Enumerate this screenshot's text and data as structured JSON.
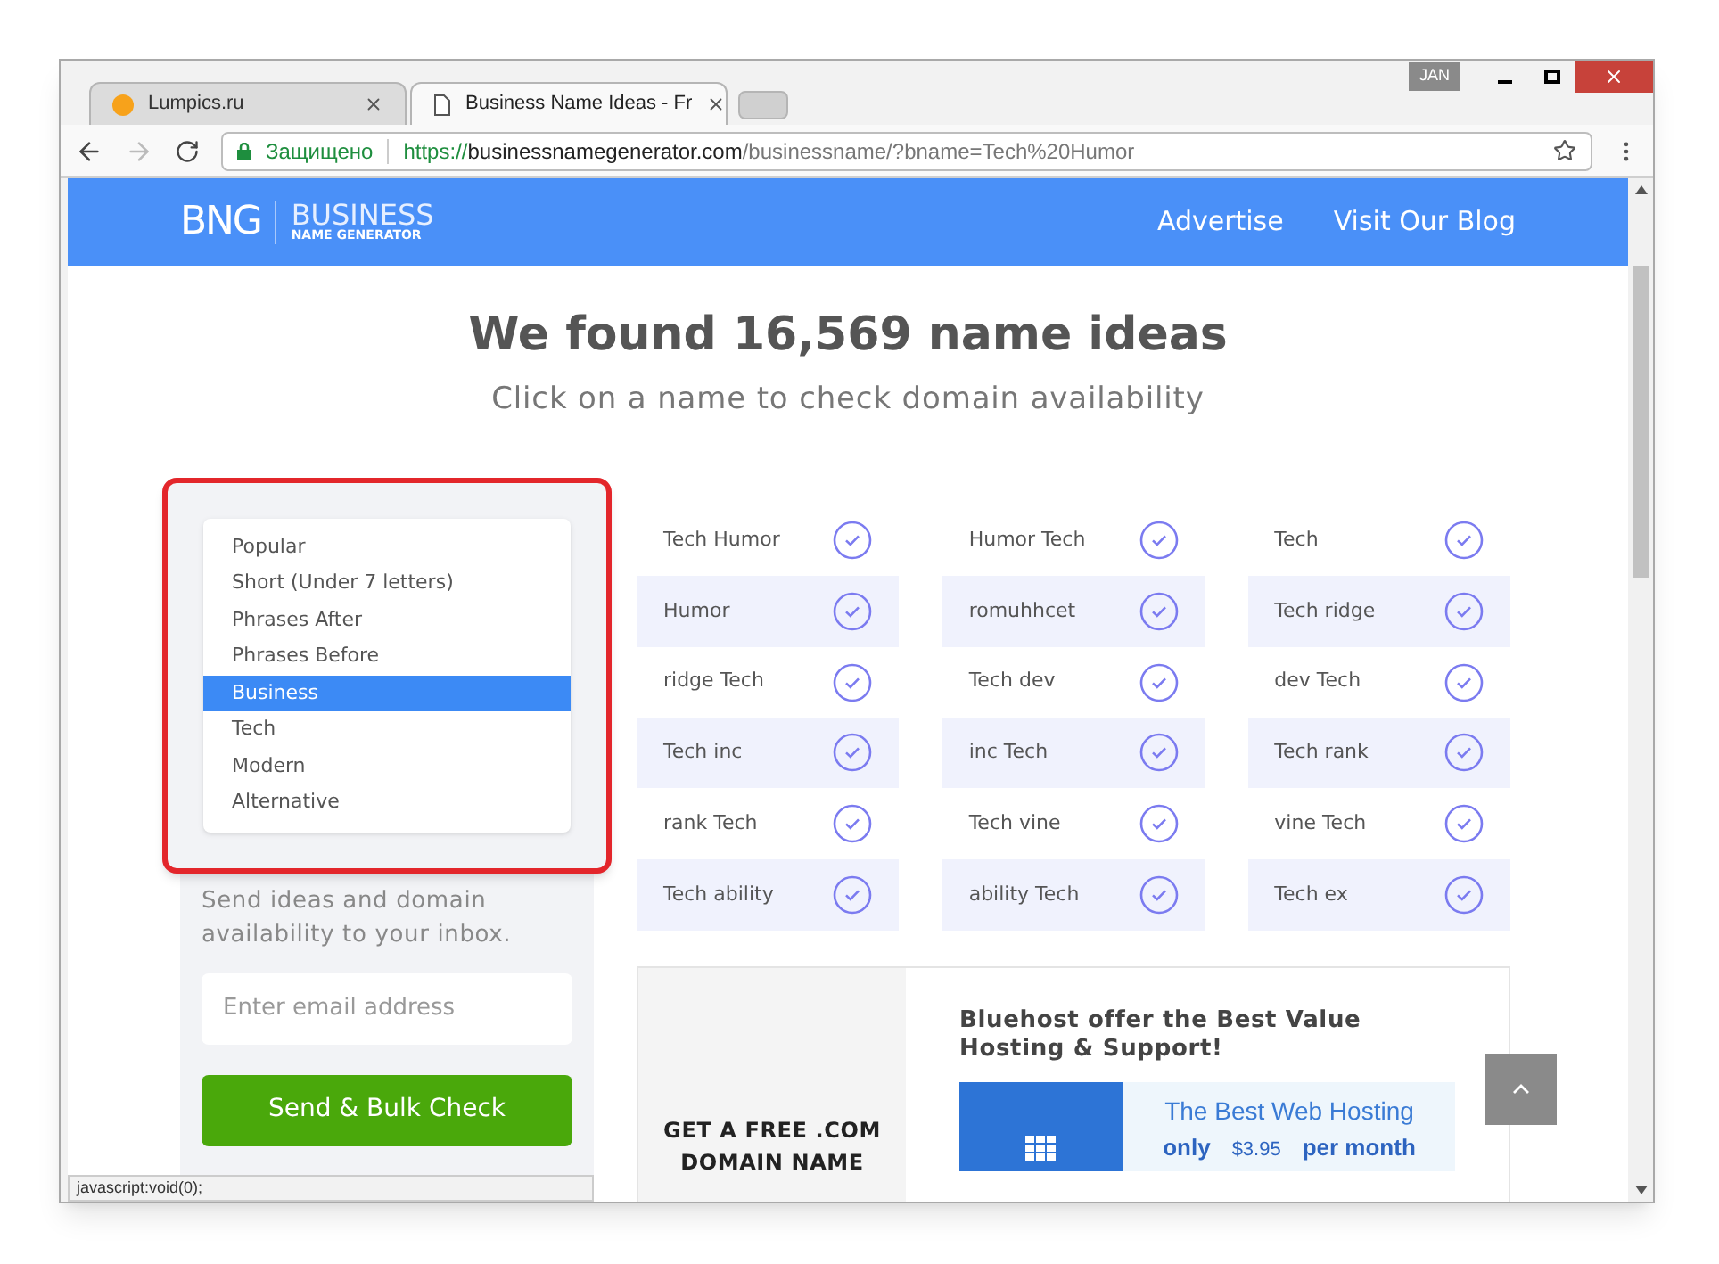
{
  "window": {
    "user_badge": "JAN"
  },
  "tabs": [
    {
      "title": "Lumpics.ru",
      "selected": false
    },
    {
      "title": "Business Name Ideas - Fr",
      "selected": true
    }
  ],
  "address_bar": {
    "secure_label": "Защищено",
    "url_scheme": "https://",
    "url_host": "businessnamegenerator.com",
    "url_path": "/businessname/?bname=Tech%20Humor"
  },
  "site_header": {
    "logo_mark": "BNG",
    "logo_title": "BUSINESS",
    "logo_subtitle": "NAME GENERATOR",
    "nav": [
      {
        "label": "Advertise"
      },
      {
        "label": "Visit Our Blog"
      }
    ]
  },
  "hero": {
    "title": "We found 16,569 name ideas",
    "subtitle": "Click on a name to check domain availability"
  },
  "category_list": [
    {
      "label": "Popular",
      "selected": false
    },
    {
      "label": "Short (Under 7 letters)",
      "selected": false
    },
    {
      "label": "Phrases After",
      "selected": false
    },
    {
      "label": "Phrases Before",
      "selected": false
    },
    {
      "label": "Business",
      "selected": true
    },
    {
      "label": "Tech",
      "selected": false
    },
    {
      "label": "Modern",
      "selected": false
    },
    {
      "label": "Alternative",
      "selected": false
    }
  ],
  "signup": {
    "text": "Send ideas and domain availability to your inbox.",
    "email_placeholder": "Enter email address",
    "button": "Send & Bulk Check"
  },
  "names": [
    [
      "Tech Humor",
      "Humor Tech",
      "Tech"
    ],
    [
      "Humor",
      "romuhhcet",
      "Tech ridge"
    ],
    [
      "ridge Tech",
      "Tech dev",
      "dev Tech"
    ],
    [
      "Tech inc",
      "inc Tech",
      "Tech rank"
    ],
    [
      "rank Tech",
      "Tech vine",
      "vine Tech"
    ],
    [
      "Tech ability",
      "ability Tech",
      "Tech ex"
    ]
  ],
  "ad": {
    "left_text": "GET A FREE .COM DOMAIN NAME",
    "title": "Bluehost offer the Best Value Hosting & Support!",
    "banner_title": "The Best Web Hosting",
    "banner_only": "only",
    "banner_price": "$3.95",
    "banner_period": "per month"
  },
  "status_bar": "javascript:void(0);"
}
